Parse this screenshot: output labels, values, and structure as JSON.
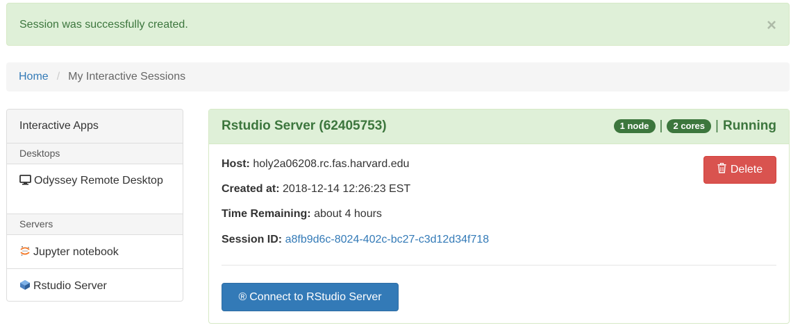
{
  "alert": {
    "message": "Session was successfully created.",
    "close_glyph": "×"
  },
  "breadcrumb": {
    "home": "Home",
    "separator": "/",
    "current": "My Interactive Sessions"
  },
  "sidebar": {
    "heading": "Interactive Apps",
    "sections": [
      {
        "label": "Desktops"
      },
      {
        "label": "Servers"
      }
    ],
    "items": [
      {
        "label": "Odyssey Remote Desktop",
        "icon": "monitor-icon"
      },
      {
        "label": "Jupyter notebook",
        "icon": "jupyter-icon"
      },
      {
        "label": "Rstudio Server",
        "icon": "rstudio-icon"
      }
    ]
  },
  "session": {
    "title": "Rstudio Server (62405753)",
    "nodes_badge": "1 node",
    "cores_badge": "2 cores",
    "separator": "|",
    "status": "Running",
    "host_label": "Host:",
    "host_value": "holy2a06208.rc.fas.harvard.edu",
    "created_label": "Created at:",
    "created_value": "2018-12-14 12:26:23 EST",
    "time_label": "Time Remaining:",
    "time_value": "about 4 hours",
    "session_id_label": "Session ID:",
    "session_id_value": "a8fb9d6c-8024-402c-bc27-c3d12d34f718",
    "delete_label": "Delete",
    "connect_label": "Connect to RStudio Server",
    "connect_glyph": "®"
  },
  "colors": {
    "success_bg": "#dff0d8",
    "success_text": "#3c763d",
    "link": "#337ab7",
    "danger": "#d9534f",
    "primary": "#337ab7"
  }
}
